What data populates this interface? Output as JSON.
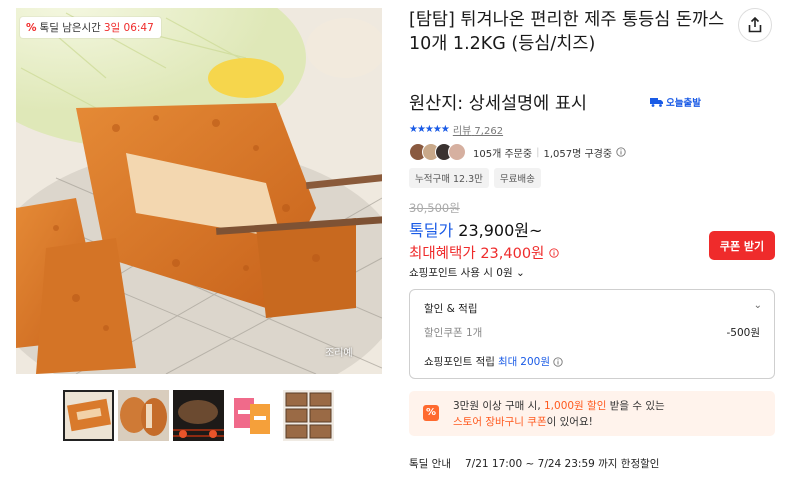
{
  "timer": {
    "icon": "percent-icon",
    "label": "톡딜 남은시간",
    "days": "3일",
    "time": "06:47"
  },
  "hero": {
    "watermark": "조리예"
  },
  "thumbnails": [
    {
      "name": "thumb-cutlet-closeup"
    },
    {
      "name": "thumb-cutlet-platter"
    },
    {
      "name": "thumb-cutlet-grill"
    },
    {
      "name": "thumb-product-packages"
    },
    {
      "name": "thumb-product-trays"
    }
  ],
  "product": {
    "title": "[탐탐] 튀겨나온 편리한 제주 통등심 돈까스 10개 1.2KG (등심/치즈)",
    "origin": "원산지: 상세설명에 표시",
    "today_ship": "오늘출발"
  },
  "rating": {
    "stars": "★★★★★",
    "review_label": "리뷰",
    "review_count": "7,262"
  },
  "social": {
    "orders": "105개 주문중",
    "subscribers": "1,057명 구경중"
  },
  "tags": [
    "누적구매 12.3만",
    "무료배송"
  ],
  "price": {
    "original": "30,500원",
    "deal_label": "톡딜가",
    "deal_value": "23,900원~",
    "max_label": "최대혜택가",
    "max_value": "23,400원",
    "coupon_button": "쿠폰 받기",
    "points": "쇼핑포인트 사용 시 0원"
  },
  "discount_box": {
    "header": "할인 & 적립",
    "coupon_label": "할인쿠폰 1개",
    "coupon_value": "-500원",
    "points_label": "쇼핑포인트 적립",
    "points_max": "최대",
    "points_value": "200원"
  },
  "banner": {
    "line1_a": "3만원 이상 구매 시,",
    "line1_b": "1,000원 할인",
    "line1_c": "받을 수 있는",
    "line2_a": "스토어 장바구니 쿠폰",
    "line2_b": "이 있어요!"
  },
  "deal_info": {
    "label": "톡딜 안내",
    "period": "7/21 17:00 ~ 7/24 23:59 까지 한정할인"
  },
  "colors": {
    "accent_red": "#ef2b2b",
    "accent_blue": "#1a5be6",
    "banner_bg": "#fff3ec",
    "banner_orange": "#ff5a1f"
  }
}
